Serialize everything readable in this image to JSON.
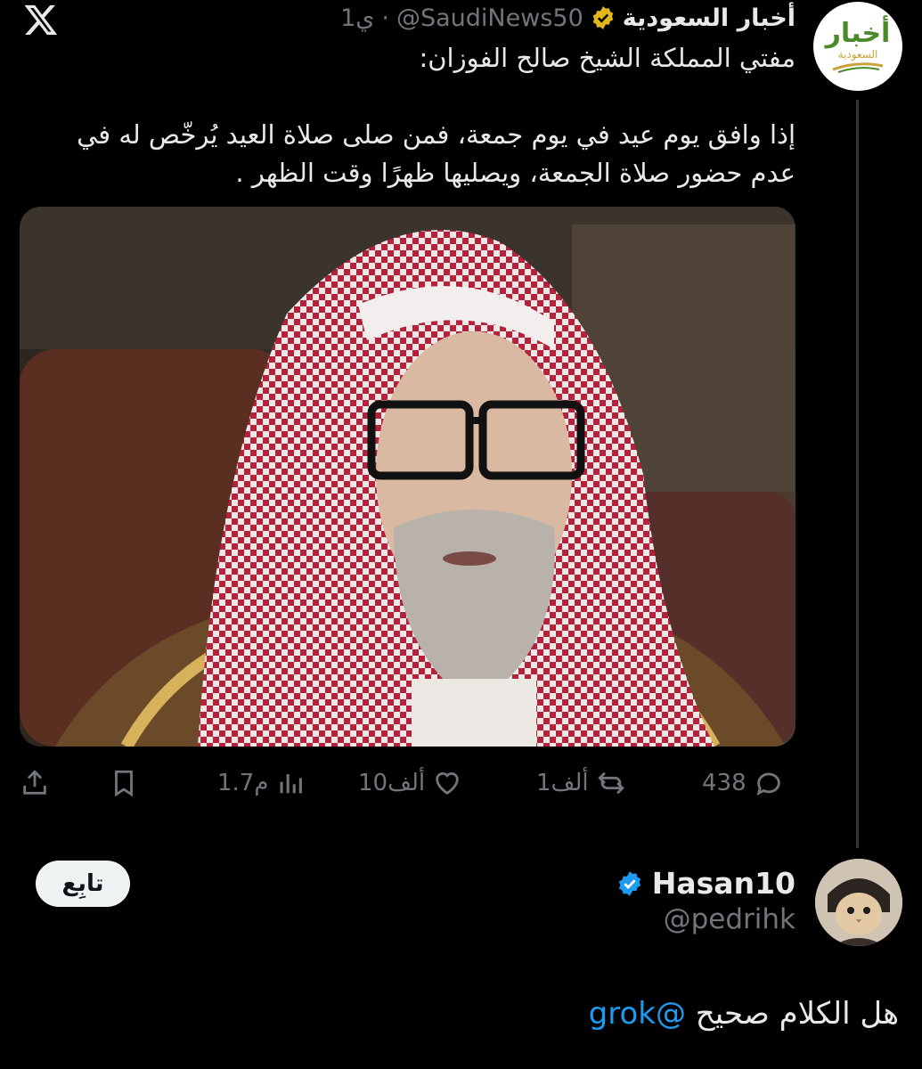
{
  "app": {
    "brand_icon": "x-logo-icon"
  },
  "tweet": {
    "author_name": "أخبار السعودية",
    "author_verified_icon": "gold-verified-badge-icon",
    "handle": "@SaudiNews50",
    "separator": "·",
    "time": "1ي",
    "avatar_logo_text": "أخبار",
    "avatar_logo_subtext": "السعودية",
    "lines": [
      "مفتي المملكة الشيخ صالح الفوزان:",
      "",
      "إذا وافق يوم عيد في يوم جمعة، فمن صلى صلاة العيد يُرخّص له في",
      "عدم حضور صلاة الجمعة، ويصليها ظهرًا وقت الظهر ."
    ],
    "media_description": "photo-sheikh",
    "actions": {
      "replies": "438",
      "retweets": "1ألف",
      "likes": "10ألف",
      "views": "1.7م"
    }
  },
  "reply": {
    "author_name": "Hasan10",
    "verified_icon": "blue-verified-badge-icon",
    "handle": "@pedrihk",
    "follow_label": "تابِع",
    "text_before": "هل الكلام صحيح ",
    "mention": "@grok"
  },
  "colors": {
    "background": "#000000",
    "text": "#e7e9ea",
    "muted": "#71767b",
    "link": "#1d9bf0",
    "gold_badge": "#e2b719",
    "blue_badge": "#1d9bf0",
    "brand_green": "#4a8a2a"
  }
}
